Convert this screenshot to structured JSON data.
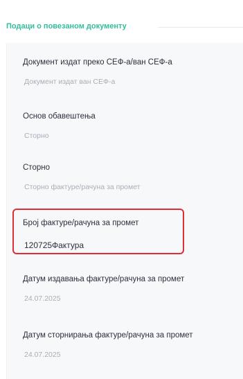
{
  "section": {
    "title": "Подаци о повезаном документу"
  },
  "fields": [
    {
      "label": "Документ издат преко СЕФ-а/ван СЕФ-а",
      "value": "Документ издат ван СЕФ-а"
    },
    {
      "label": "Основ обавештења",
      "value": "Сторно"
    },
    {
      "label": "Сторно",
      "value": "Сторно фактуре/рачуна за промет"
    },
    {
      "label": "Број фактуре/рачуна за промет",
      "value": "120725Фактура"
    },
    {
      "label": "Датум издавања фактуре/рачуна за промет",
      "value": "24.07.2025"
    },
    {
      "label": "Датум сторнирања фактуре/рачуна за промет",
      "value": "24.07.2025"
    }
  ],
  "colors": {
    "accent": "#2fbf9a",
    "highlight": "#e02c35"
  }
}
